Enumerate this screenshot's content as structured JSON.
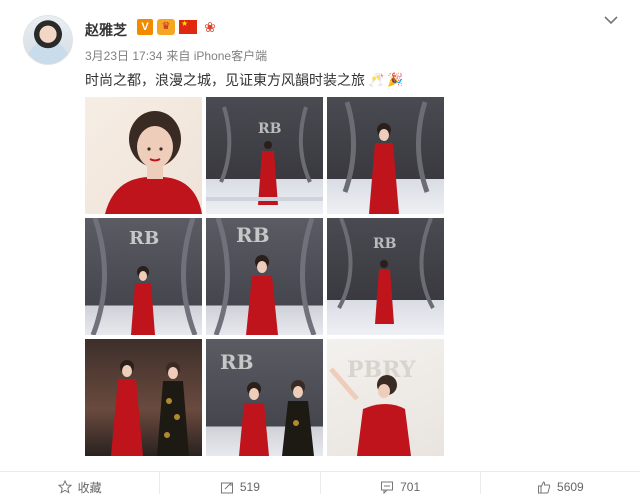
{
  "user": {
    "name": "赵雅芝",
    "verified_badge": "V"
  },
  "post": {
    "date": "3月23日 17:34",
    "source": "来自 iPhone客户端",
    "text": "时尚之都，浪漫之城，见证東方风韻时装之旅"
  },
  "photos": [
    {
      "id": "photo-1",
      "logo": ""
    },
    {
      "id": "photo-2",
      "logo": "RB"
    },
    {
      "id": "photo-3",
      "logo": ""
    },
    {
      "id": "photo-4",
      "logo": "RB"
    },
    {
      "id": "photo-5",
      "logo": "RB"
    },
    {
      "id": "photo-6",
      "logo": "RB"
    },
    {
      "id": "photo-7",
      "logo": ""
    },
    {
      "id": "photo-8",
      "logo": "RB"
    },
    {
      "id": "photo-9",
      "logo": "PBRY"
    }
  ],
  "footer": {
    "favorite_label": "收藏",
    "repost_count": "519",
    "comment_count": "701",
    "like_count": "5609"
  },
  "colors": {
    "accent": "#f28a00",
    "dress_red": "#c0141d",
    "text_muted": "#808080"
  }
}
